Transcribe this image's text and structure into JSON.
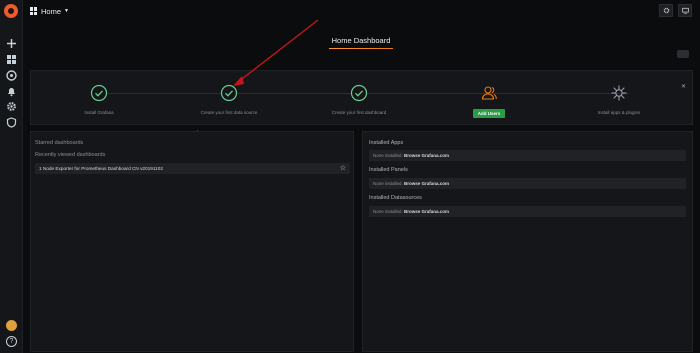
{
  "topbar": {
    "home_label": "Home",
    "settings_icon": "gear-icon",
    "tv_icon": "monitor-icon"
  },
  "sidebar": {
    "items": [
      {
        "icon": "plus-icon"
      },
      {
        "icon": "dashboards-icon"
      },
      {
        "icon": "explore-icon"
      },
      {
        "icon": "bell-icon"
      },
      {
        "icon": "gear-icon"
      },
      {
        "icon": "shield-icon"
      }
    ],
    "help_glyph": "?"
  },
  "page": {
    "title": "Home Dashboard"
  },
  "getting_started": {
    "steps": [
      {
        "label": "Install Grafana",
        "icon": "check-circle-icon",
        "done": true
      },
      {
        "label": "Create your first data source",
        "icon": "check-circle-icon",
        "done": true
      },
      {
        "label": "Create your first dashboard",
        "icon": "check-circle-icon",
        "done": true
      },
      {
        "label": "",
        "icon": "users-icon",
        "done": false,
        "button": "Add Users"
      },
      {
        "label": "Install apps & plugins",
        "icon": "plugins-icon",
        "done": false
      }
    ]
  },
  "left_panel": {
    "starred_heading": "Starred dashboards",
    "recent_heading": "Recently viewed dashboards",
    "recent": [
      {
        "title": "1 Node Exporter for Prometheus Dashboard CN v20191102"
      }
    ]
  },
  "right_panel": {
    "sections": [
      {
        "heading": "Installed Apps",
        "none_text": "None installed.",
        "link_text": "Browse Grafana.com"
      },
      {
        "heading": "Installed Panels",
        "none_text": "None installed.",
        "link_text": "Browse Grafana.com"
      },
      {
        "heading": "Installed Datasources",
        "none_text": "None installed.",
        "link_text": "Browse Grafana.com"
      }
    ]
  },
  "colors": {
    "accent": "#eb7b18",
    "success": "#299c46",
    "check": "#6ccf8e",
    "background": "#0b0c0e",
    "panel": "#141619",
    "annotation_arrow": "#c4161c"
  }
}
